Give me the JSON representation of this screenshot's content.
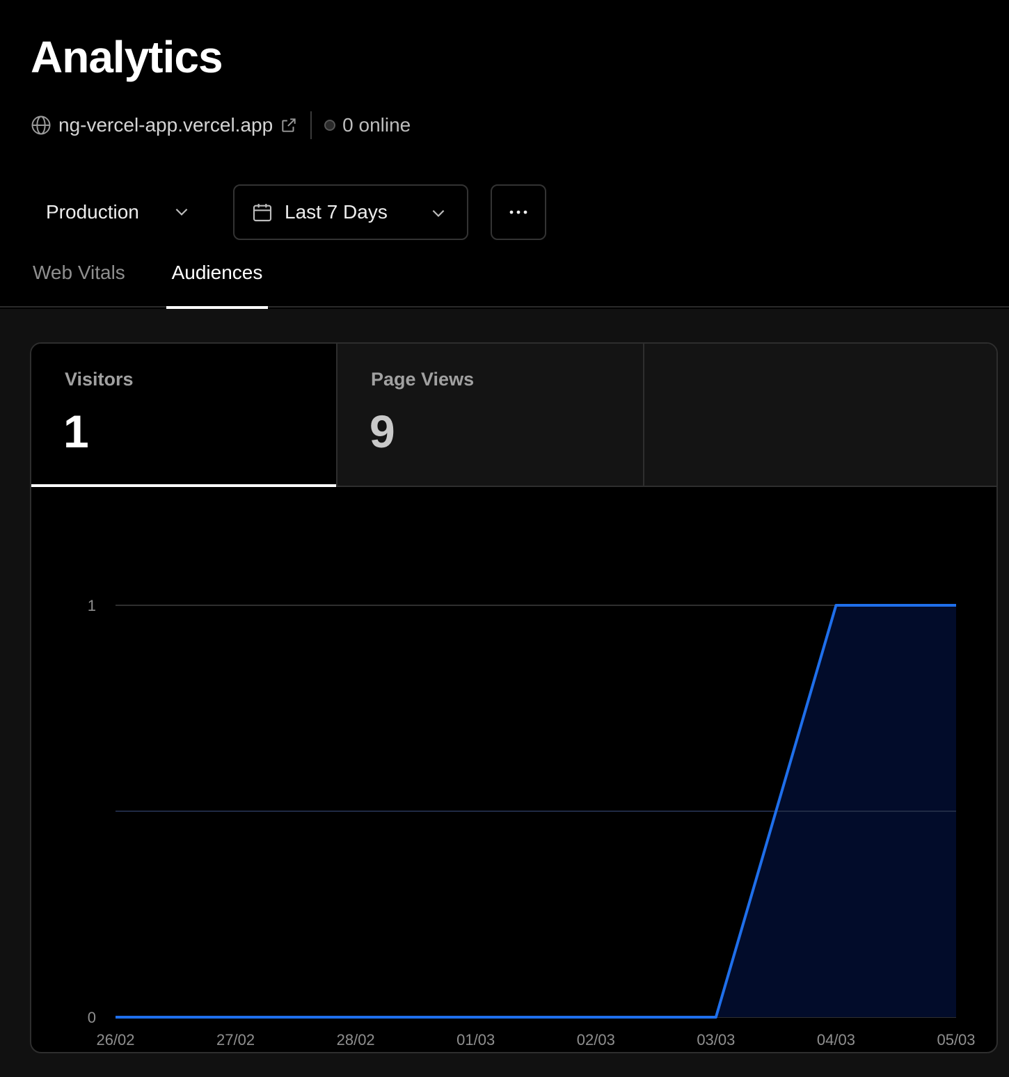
{
  "header": {
    "title": "Analytics",
    "domain": "ng-vercel-app.vercel.app",
    "online": "0 online"
  },
  "controls": {
    "environment": "Production",
    "date_range": "Last 7 Days"
  },
  "tabs": [
    {
      "label": "Web Vitals",
      "active": false
    },
    {
      "label": "Audiences",
      "active": true
    }
  ],
  "stats": [
    {
      "label": "Visitors",
      "value": "1",
      "active": true
    },
    {
      "label": "Page Views",
      "value": "9",
      "active": false
    }
  ],
  "colors": {
    "line": "#1f6feb",
    "area": "#020c2a",
    "grid": "#2f2f2f"
  },
  "chart_data": {
    "type": "area",
    "categories": [
      "26/02",
      "27/02",
      "28/02",
      "01/03",
      "02/03",
      "03/03",
      "04/03",
      "05/03"
    ],
    "series": [
      {
        "values": [
          0,
          0,
          0,
          0,
          0,
          0,
          1,
          1
        ]
      }
    ],
    "yticks": [
      "0",
      "1"
    ],
    "ylim": [
      0,
      1
    ],
    "grid": true
  }
}
